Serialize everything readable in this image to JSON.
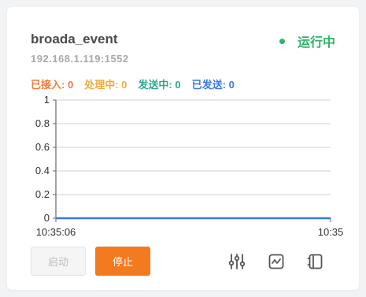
{
  "card": {
    "title": "broada_event",
    "status": "运行中",
    "address": "192.168.1.119:1552",
    "stats": [
      {
        "label": "已接入:",
        "value": "0"
      },
      {
        "label": "处理中:",
        "value": "0"
      },
      {
        "label": "发送中:",
        "value": "0"
      },
      {
        "label": "已发送:",
        "value": "0"
      }
    ]
  },
  "chart_data": {
    "type": "line",
    "x": [
      "10:35:06",
      "10:35"
    ],
    "series": [
      {
        "values": [
          0,
          0
        ]
      }
    ],
    "yticks": [
      "0",
      "0.2",
      "0.4",
      "0.6",
      "0.8",
      "1"
    ],
    "xticks": [
      "10:35:06",
      "10:35"
    ],
    "ylim": [
      0,
      1
    ],
    "grid": true,
    "line_color": "#3a78e0"
  },
  "buttons": {
    "start_label": "启动",
    "stop_label": "停止"
  },
  "icons": [
    "sliders-icon",
    "chart-monitor-icon",
    "panel-icon"
  ]
}
